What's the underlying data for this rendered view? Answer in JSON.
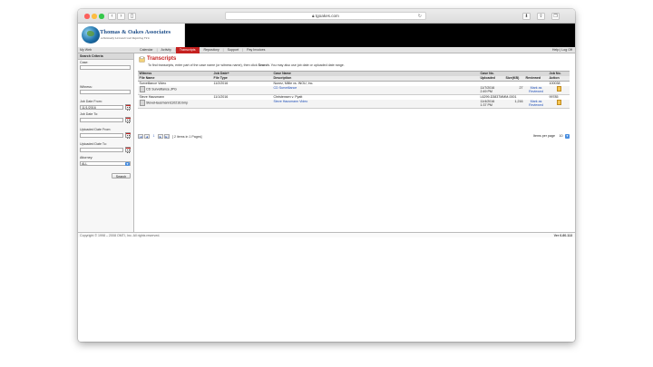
{
  "browser": {
    "url": "tgoakes.com",
    "lock_icon": "lock-icon"
  },
  "site": {
    "logo_title": "Thomas & Oakes Associates",
    "logo_tagline": "A Nationally Licensed Court Reporting Firm"
  },
  "nav": {
    "my_web": "My Web",
    "menu": [
      "Calendar",
      "Activity",
      "Transcripts",
      "Repository",
      "Support",
      "Pay Invoices"
    ],
    "active": "Transcripts",
    "help": "Help",
    "logoff": "Log Off"
  },
  "search_panel": {
    "title": "Search Criteria",
    "case_label": "Case:",
    "case_value": "",
    "witness_label": "Witness:",
    "witness_value": "",
    "job_date_from_label": "Job Date From:",
    "job_date_from_value": "11/1/2016",
    "job_date_to_label": "Job Date To:",
    "job_date_to_value": "",
    "uploaded_from_label": "Uploaded Date From:",
    "uploaded_from_value": "",
    "uploaded_to_label": "Uploaded Date To:",
    "uploaded_to_value": "",
    "attorney_label": "Attorney:",
    "attorney_value": "ALL",
    "search_button": "Search"
  },
  "main": {
    "title": "Transcripts",
    "instructions_pre": "To find transcripts, enter part of the case name (or witness name), then click ",
    "instructions_bold": "Search",
    "instructions_post": ". You may also use job date or uploaded date range.",
    "columns_top": [
      "Witness",
      "Job Date+",
      "Case Name",
      "Case No.",
      "",
      "",
      "Job No."
    ],
    "columns_sub": [
      "File Name",
      "File Type",
      "Description",
      "Uploaded",
      "Size(KB)",
      "Reviewed",
      "Action"
    ],
    "rows": [
      {
        "witness": "Surveillance Video",
        "job_date": "11/2/2016",
        "case_name": "Nunez, Millie vs. INOU, Inc.",
        "case_no": "",
        "job_no": "100038",
        "file_name": "CD Surveillance.JPG",
        "file_type": "",
        "description": "CD Surveillance",
        "uploaded_date": "11/7/2016",
        "uploaded_time": "2:49 PM",
        "size": "27",
        "reviewed_1": "Mark as",
        "reviewed_2": "Reviewed"
      },
      {
        "witness": "Steve Hausmann",
        "job_date": "11/1/2016",
        "case_name": "Christensen v. Pyatt",
        "case_no": "L6299-D3837MMM-0001",
        "job_no": "99785",
        "file_name": "SteveHausmann110216.bmp",
        "file_type": "",
        "description": "Steve Hausmann Video",
        "uploaded_date": "11/4/2016",
        "uploaded_time": "1:37 PM",
        "size": "1,216",
        "reviewed_1": "Mark as",
        "reviewed_2": "Reviewed"
      }
    ],
    "pager": {
      "first": "|◀",
      "prev": "◀",
      "current": "1",
      "next": "▶",
      "last": "▶|",
      "summary": "[ 2 items in 1 Pages]",
      "items_per_page_label": "Items per page",
      "items_per_page": "10"
    }
  },
  "footer": {
    "copyright": "Copyright © 1998 – 2008 OMTI, Inc. All rights reserved.",
    "version": "Ver 6.80.113"
  }
}
